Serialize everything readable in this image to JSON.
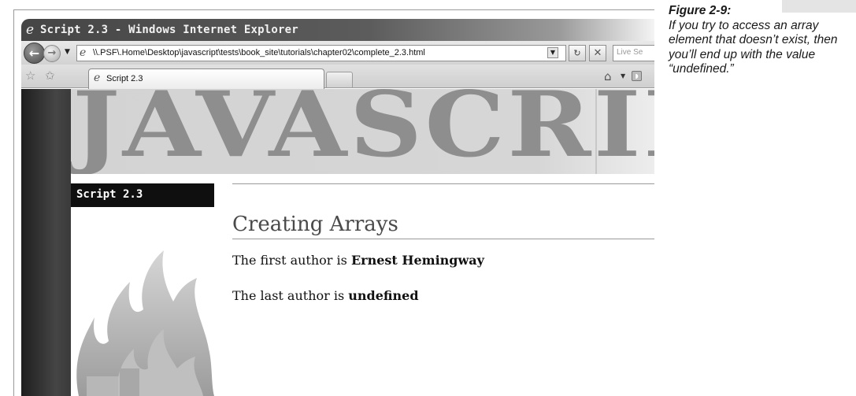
{
  "window": {
    "title": "Script 2.3 - Windows Internet Explorer",
    "address_url": "\\\\.PSF\\.Home\\Desktop\\javascript\\tests\\book_site\\tutorials\\chapter02\\complete_2.3.html",
    "search_placeholder": "Live Se",
    "tab_label": "Script 2.3"
  },
  "page": {
    "banner_text": "JAVASCRIPT",
    "sidebar_heading": "Script 2.3",
    "heading": "Creating Arrays",
    "line1_prefix": "The first author is ",
    "line1_value": "Ernest Hemingway",
    "line2_prefix": "The last author is ",
    "line2_value": "undefined"
  },
  "caption": {
    "figure_label": "Figure 2-9:",
    "text": "If you try to access an array element that doesn’t exist, then you’ll end up with the value “undefined.”"
  },
  "icons": {
    "back": "back-arrow-icon",
    "forward": "forward-arrow-icon",
    "refresh": "refresh-icon",
    "stop": "stop-icon",
    "favorites": "star-icon",
    "add_favorite": "add-favorite-icon",
    "home": "home-icon",
    "feeds": "rss-feed-icon"
  }
}
